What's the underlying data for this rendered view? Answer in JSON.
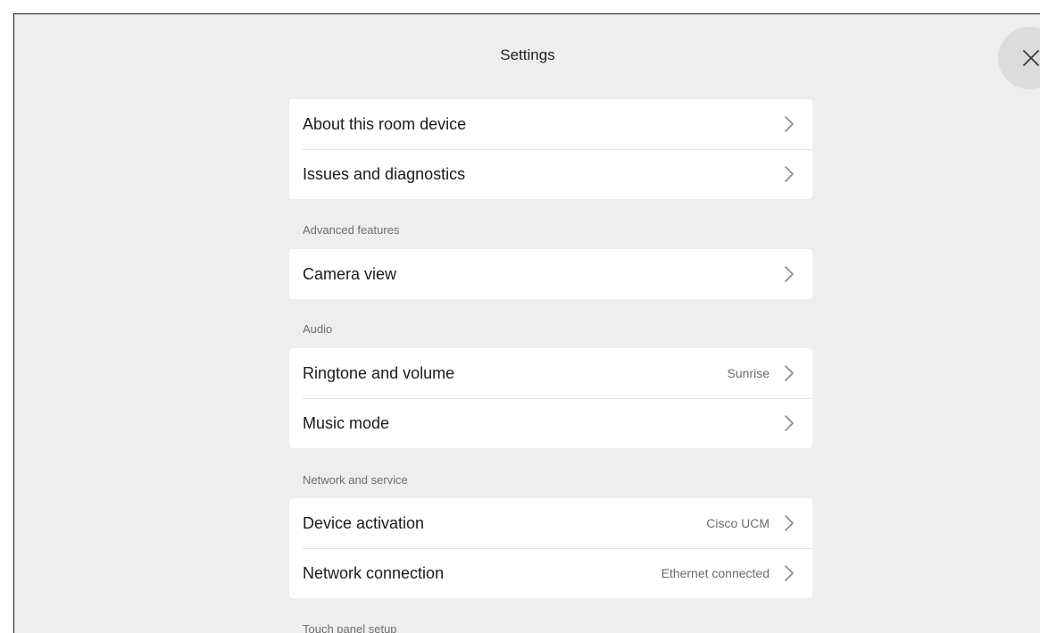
{
  "header": {
    "title": "Settings",
    "close_icon": "close-icon"
  },
  "groups": [
    {
      "header": "",
      "items": [
        {
          "label": "About this room device",
          "value": ""
        },
        {
          "label": "Issues and diagnostics",
          "value": ""
        }
      ]
    },
    {
      "header": "Advanced features",
      "items": [
        {
          "label": "Camera view",
          "value": ""
        }
      ]
    },
    {
      "header": "Audio",
      "items": [
        {
          "label": "Ringtone and volume",
          "value": "Sunrise"
        },
        {
          "label": "Music mode",
          "value": ""
        }
      ]
    },
    {
      "header": "Network and service",
      "items": [
        {
          "label": "Device activation",
          "value": "Cisco UCM"
        },
        {
          "label": "Network connection",
          "value": "Ethernet connected"
        }
      ]
    },
    {
      "header": "Touch panel setup",
      "items": []
    }
  ],
  "colors": {
    "background": "#eeeeee",
    "card": "#ffffff",
    "close_button": "#dcdcdc",
    "text_primary": "#1a1a1a",
    "text_secondary": "#6a6a6a",
    "chevron": "#8a8a8a"
  },
  "icons": {
    "row_chevron": "chevron-right-icon"
  }
}
